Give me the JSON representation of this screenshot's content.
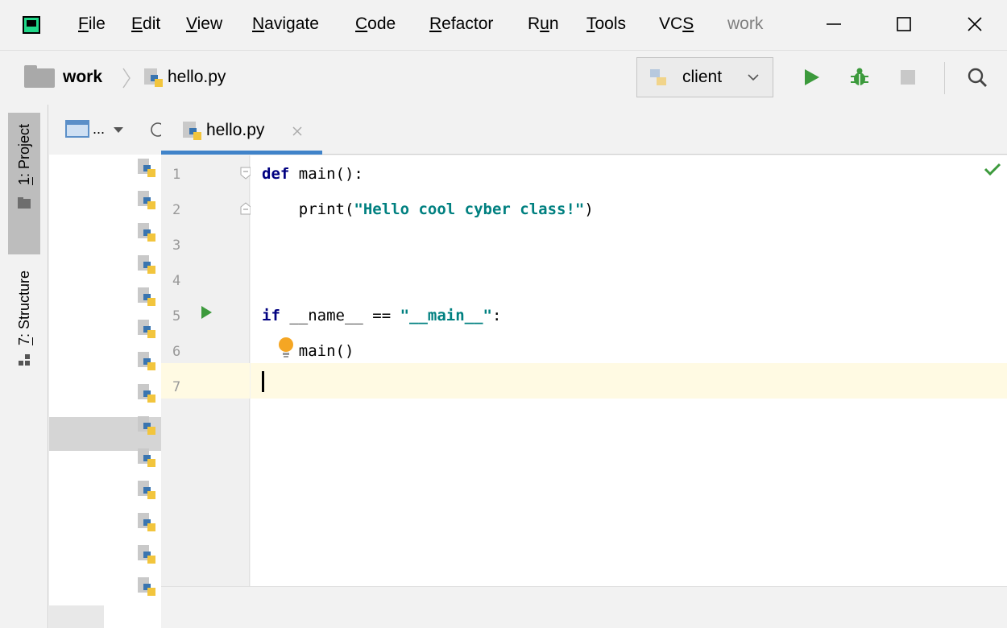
{
  "menubar": {
    "items": [
      {
        "label": "File",
        "ul": "F"
      },
      {
        "label": "Edit",
        "ul": "E"
      },
      {
        "label": "View",
        "ul": "V"
      },
      {
        "label": "Navigate",
        "ul": "N"
      },
      {
        "label": "Code",
        "ul": "C"
      },
      {
        "label": "Refactor",
        "ul": "R"
      },
      {
        "label": "Run",
        "ul": "u"
      },
      {
        "label": "Tools",
        "ul": "T"
      },
      {
        "label": "VCS",
        "ul": "S"
      }
    ],
    "window_title": "work"
  },
  "navbar": {
    "project_name": "work",
    "file_name": "hello.py",
    "run_config": "client"
  },
  "toolstrip": {
    "project_tab": "1: Project",
    "structure_tab": "7: Structure"
  },
  "project_panel": {
    "header_text": "..."
  },
  "editor": {
    "tab_label": "hello.py",
    "line_numbers": [
      "1",
      "2",
      "3",
      "4",
      "5",
      "6",
      "7"
    ],
    "code": {
      "l1_kw": "def",
      "l1_rest": " main():",
      "l2_pre": "    print(",
      "l2_str": "\"Hello cool cyber class!\"",
      "l2_post": ")",
      "l5_kw": "if",
      "l5_mid": " __name__ == ",
      "l5_str": "\"__main__\"",
      "l5_post": ":",
      "l6": "    main()"
    }
  },
  "colors": {
    "keyword": "#000080",
    "string": "#008080",
    "run_green": "#3c9a3c",
    "accent_blue": "#4083c9",
    "caret_line": "#fffae3"
  }
}
